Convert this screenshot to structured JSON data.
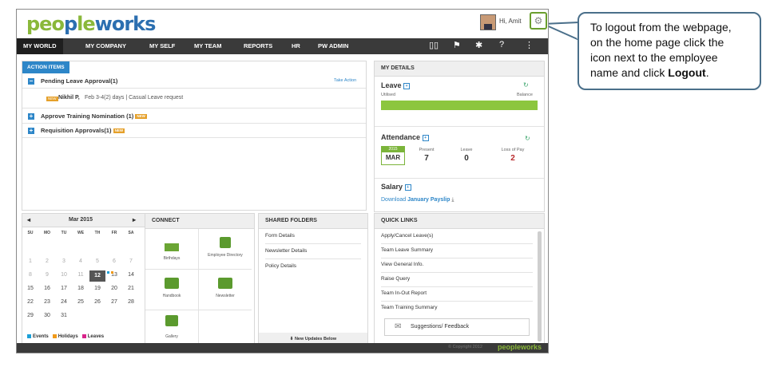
{
  "header": {
    "logo": "peopleworks",
    "greeting": "Hi, Amit"
  },
  "nav": {
    "items": [
      "MY WORLD",
      "MY COMPANY",
      "MY SELF",
      "MY TEAM",
      "REPORTS",
      "HR",
      "PW ADMIN"
    ],
    "active": "MY WORLD"
  },
  "action_items": {
    "tab": "ACTION ITEMS",
    "pending": {
      "label": "Pending Leave Approval(1)",
      "take_action": "Take Action"
    },
    "pending_detail": {
      "name": "Nikhil P,",
      "text": "Feb 3-4(2) days | Casual Leave request"
    },
    "training": "Approve Training Nomination (1)",
    "requisition": "Requisition Approvals(1)",
    "new_badge": "NEW"
  },
  "my_details": {
    "title": "MY DETAILS",
    "leave": {
      "label": "Leave",
      "utilised": "Utilised",
      "balance": "Balance"
    },
    "attendance": {
      "label": "Attendance",
      "year": "2015",
      "month": "MAR",
      "present_label": "Present",
      "present": "7",
      "leave_label": "Leave",
      "leave": "0",
      "lop_label": "Loss of Pay",
      "lop": "2"
    },
    "salary": {
      "label": "Salary",
      "download_prefix": "Download",
      "download_link": "January Payslip"
    }
  },
  "calendar": {
    "title": "Mar 2015",
    "dow": [
      "SU",
      "MO",
      "TU",
      "WE",
      "TH",
      "FR",
      "SA"
    ],
    "weeks": [
      [
        "1",
        "2",
        "3",
        "4",
        "5",
        "6",
        "7"
      ],
      [
        "8",
        "9",
        "10",
        "11",
        "12",
        "13",
        "14"
      ],
      [
        "15",
        "16",
        "17",
        "18",
        "19",
        "20",
        "21"
      ],
      [
        "22",
        "23",
        "24",
        "25",
        "26",
        "27",
        "28"
      ],
      [
        "29",
        "30",
        "31",
        "",
        "",
        "",
        ""
      ]
    ],
    "today": "12",
    "legend": [
      {
        "label": "Events",
        "color": "#1ba0d8"
      },
      {
        "label": "Holidays",
        "color": "#f09a1a"
      },
      {
        "label": "Leaves",
        "color": "#d9238b"
      }
    ]
  },
  "connect": {
    "title": "CONNECT",
    "tiles": [
      "Birthdays",
      "Employee Directory",
      "Handbook",
      "Newsletter",
      "Gallery"
    ]
  },
  "shared_folders": {
    "title": "SHARED FOLDERS",
    "items": [
      "Form Details",
      "Newsletter Details",
      "Policy Details"
    ],
    "footer": "New Updates Below"
  },
  "quick_links": {
    "title": "QUICK LINKS",
    "items": [
      "Apply/Cancel Leave(s)",
      "Team Leave Summary",
      "View General Info.",
      "Raise Query",
      "Team In-Out Report",
      "Team Training Summary"
    ],
    "suggestions": "Suggestions/ Feedback"
  },
  "footer": {
    "copyright": "© Copyright 2012",
    "logo": "peopleworks"
  },
  "callout": {
    "line_a": "To logout  from the webpage,",
    "line_b": "on the home page click the",
    "line_c": "icon next to the employee",
    "line_d_prefix": "name and click ",
    "line_d_bold": "Logout",
    "line_d_suffix": "."
  },
  "colors": {
    "accent_green": "#8cc63e",
    "accent_blue": "#2d86c8",
    "nav_bg": "#3a3a3a"
  }
}
